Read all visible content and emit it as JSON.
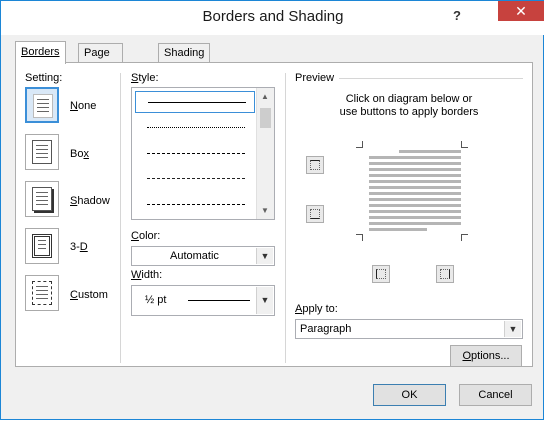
{
  "window": {
    "title": "Borders and Shading",
    "help": "?",
    "close": "✕"
  },
  "tabs": [
    {
      "label": "Borders",
      "active": true
    },
    {
      "label": "Page Border",
      "active": false
    },
    {
      "label": "Shading",
      "active": false
    }
  ],
  "setting": {
    "label": "Setting:",
    "items": [
      {
        "label": "None",
        "selected": true
      },
      {
        "label": "Box",
        "selected": false
      },
      {
        "label": "Shadow",
        "selected": false
      },
      {
        "label": "3-D",
        "selected": false
      },
      {
        "label": "Custom",
        "selected": false
      }
    ]
  },
  "style": {
    "label": "Style:"
  },
  "color": {
    "label": "Color:",
    "value": "Automatic"
  },
  "width": {
    "label": "Width:",
    "value": "½ pt"
  },
  "preview": {
    "label": "Preview",
    "instruction_line1": "Click on diagram below or",
    "instruction_line2": "use buttons to apply borders"
  },
  "apply_to": {
    "label": "Apply to:",
    "value": "Paragraph"
  },
  "buttons": {
    "options": "Options...",
    "ok": "OK",
    "cancel": "Cancel"
  },
  "colors": {
    "accent": "#3b8fd8",
    "close_button": "#c7423e",
    "window_border": "#1c86d6"
  }
}
